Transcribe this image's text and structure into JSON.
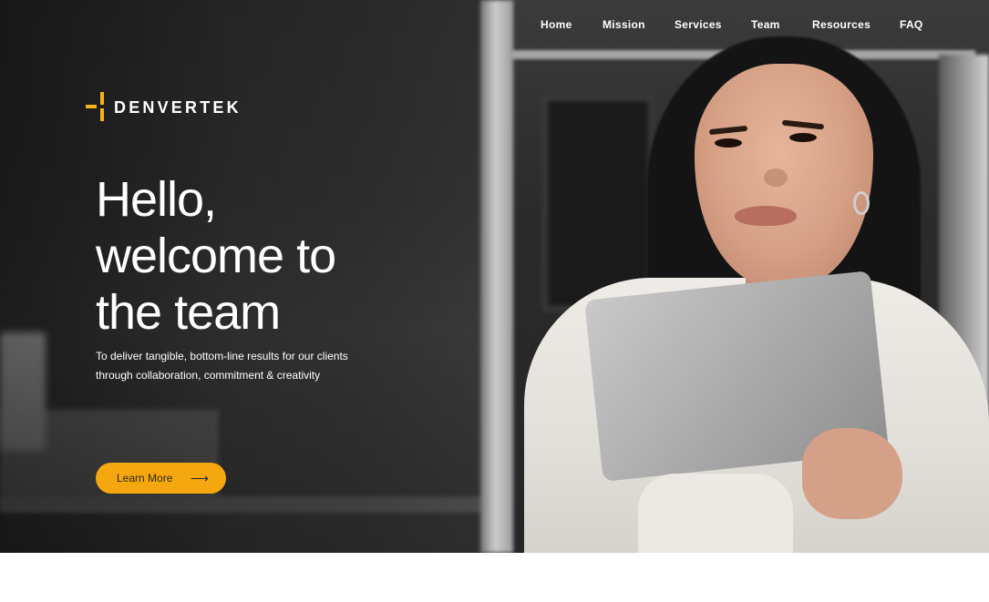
{
  "nav": {
    "items": [
      {
        "label": "Home"
      },
      {
        "label": "Mission"
      },
      {
        "label": "Services"
      },
      {
        "label": "Team"
      },
      {
        "label": "Resources"
      },
      {
        "label": "FAQ"
      }
    ]
  },
  "brand": {
    "name": "DENVERTEK",
    "accent_color": "#f5b21a"
  },
  "hero": {
    "headline_line1": "Hello,",
    "headline_line2": "welcome to",
    "headline_line3": "the team",
    "subtitle_line1": "To deliver tangible, bottom-line results for our clients",
    "subtitle_line2": "through collaboration, commitment & creativity",
    "cta_label": "Learn More",
    "cta_icon": "arrow-right-icon",
    "cta_color": "#f5a70f"
  }
}
